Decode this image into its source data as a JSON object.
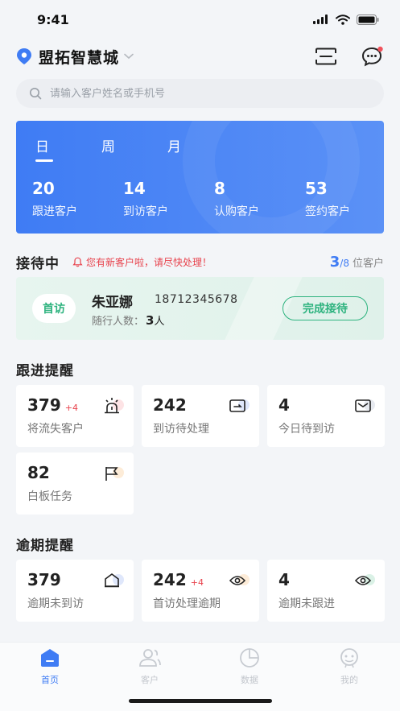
{
  "status_bar": {
    "time": "9:41"
  },
  "header": {
    "location": "盟拓智慧城",
    "accent": "#3f7cf4"
  },
  "search": {
    "placeholder": "请输入客户姓名或手机号"
  },
  "period_tabs": [
    {
      "label": "日",
      "active": true
    },
    {
      "label": "周",
      "active": false
    },
    {
      "label": "月",
      "active": false
    }
  ],
  "stats": [
    {
      "value": "20",
      "label": "跟进客户"
    },
    {
      "value": "14",
      "label": "到访客户"
    },
    {
      "value": "8",
      "label": "认购客户"
    },
    {
      "value": "53",
      "label": "签约客户"
    }
  ],
  "reception": {
    "title": "接待中",
    "alert": "您有新客户啦，请尽快处理！",
    "current": "3",
    "total": "/8",
    "unit": "位客户",
    "visitor": {
      "badge": "首访",
      "name": "朱亚娜",
      "phone": "18712345678",
      "companion_label": "随行人数：",
      "companion_count": "3",
      "companion_unit": "人",
      "action": "完成接待"
    }
  },
  "follow_up": {
    "title": "跟进提醒",
    "tiles": [
      {
        "value": "379",
        "delta": "+4",
        "label": "将流失客户",
        "icon": "alarm-icon"
      },
      {
        "value": "242",
        "delta": "",
        "label": "到访待处理",
        "icon": "visit-icon"
      },
      {
        "value": "4",
        "delta": "",
        "label": "今日待到访",
        "icon": "mail-icon"
      },
      {
        "value": "82",
        "delta": "",
        "label": "白板任务",
        "icon": "flag-icon"
      }
    ]
  },
  "overdue": {
    "title": "逾期提醒",
    "tiles": [
      {
        "value": "379",
        "delta": "",
        "label": "逾期未到访",
        "icon": "home-icon"
      },
      {
        "value": "242",
        "delta": "+4",
        "label": "首访处理逾期",
        "icon": "eye-icon"
      },
      {
        "value": "4",
        "delta": "",
        "label": "逾期未跟进",
        "icon": "eye-icon"
      }
    ]
  },
  "tabbar": [
    {
      "label": "首页",
      "icon": "home-tab-icon",
      "active": true
    },
    {
      "label": "客户",
      "icon": "customer-tab-icon",
      "active": false
    },
    {
      "label": "数据",
      "icon": "data-tab-icon",
      "active": false
    },
    {
      "label": "我的",
      "icon": "profile-tab-icon",
      "active": false
    }
  ]
}
